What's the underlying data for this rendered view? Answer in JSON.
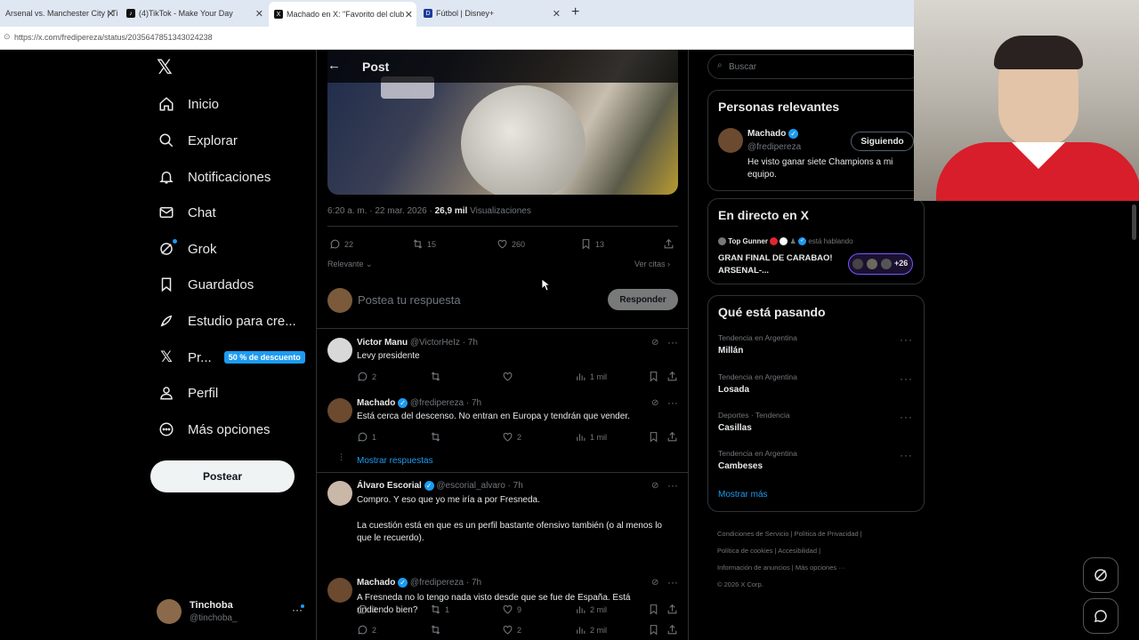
{
  "browser": {
    "tabs": [
      {
        "label": "Arsenal vs. Manchester City | Ti"
      },
      {
        "label": "(4)TikTok - Make Your Day"
      },
      {
        "label": "Machado en X: \"Favorito del club"
      },
      {
        "label": "Fútbol | Disney+"
      }
    ],
    "url": "https://x.com/fredipereza/status/2035647851343024238"
  },
  "nav": {
    "logo": "𝕏",
    "items": [
      {
        "label": "Inicio",
        "icon": "home-icon"
      },
      {
        "label": "Explorar",
        "icon": "search-icon"
      },
      {
        "label": "Notificaciones",
        "icon": "bell-icon"
      },
      {
        "label": "Chat",
        "icon": "mail-icon"
      },
      {
        "label": "Grok",
        "icon": "grok-icon"
      },
      {
        "label": "Guardados",
        "icon": "bookmark-icon"
      },
      {
        "label": "Estudio para cre...",
        "icon": "rocket-icon"
      },
      {
        "label": "Pr...",
        "icon": "x-icon"
      },
      {
        "label": "Perfil",
        "icon": "person-icon"
      },
      {
        "label": "Más opciones",
        "icon": "more-circle-icon"
      }
    ],
    "premium_badge": "50 % de descuento",
    "post_button": "Postear",
    "account": {
      "name": "Tinchoba",
      "handle": "@tinchoba_"
    }
  },
  "post": {
    "header_title": "Post",
    "meta_time": "6:20 a. m. · 22 mar. 2026 · ",
    "meta_views": "26,9 mil",
    "meta_views_label": " Visualizaciones",
    "stats": {
      "replies": "22",
      "reposts": "15",
      "likes": "260",
      "bookmarks": "13"
    },
    "sort_label": "Relevante",
    "quotes_link": "Ver citas",
    "reply_placeholder": "Postea tu respuesta",
    "reply_button": "Responder"
  },
  "replies": [
    {
      "name": "Victor Manu",
      "handle": "@VictorHeIz · 7h",
      "verified": false,
      "text": "Levy presidente",
      "replies": "2",
      "reposts": "",
      "likes": "",
      "views": "1 mil"
    },
    {
      "name": "Machado",
      "handle": "@fredipereza · 7h",
      "verified": true,
      "text": "Está cerca del descenso. No entran en Europa y tendrán que vender.",
      "replies": "1",
      "reposts": "",
      "likes": "2",
      "views": "1 mil"
    },
    {
      "show_replies": "Mostrar respuestas"
    },
    {
      "name": "Álvaro Escorial",
      "handle": "@escorial_alvaro · 7h",
      "verified": true,
      "text": "Compro. Y eso que yo me iría a por Fresneda.",
      "text2": "La cuestión está en que es un perfil bastante ofensivo también (o al menos lo que le recuerdo).",
      "replies": "3",
      "reposts": "1",
      "likes": "9",
      "views": "2 mil"
    },
    {
      "name": "Machado",
      "handle": "@fredipereza · 7h",
      "verified": true,
      "text": "A Fresneda no lo tengo nada visto desde que se fue de España. Está rindiendo bien?",
      "replies": "2",
      "reposts": "",
      "likes": "2",
      "views": "2 mil"
    }
  ],
  "right": {
    "search_placeholder": "Buscar",
    "relevant": {
      "title": "Personas relevantes",
      "name": "Machado",
      "handle": "@fredipereza",
      "follow_button": "Siguiendo",
      "bio": "He visto ganar siete Champions a mi equipo."
    },
    "live": {
      "title": "En directo en X",
      "host": "Top Gunner",
      "status": "está hablando",
      "event": "GRAN FINAL DE CARABAO! ARSENAL-...",
      "listeners": "+26"
    },
    "trends": {
      "title": "Qué está pasando",
      "items": [
        {
          "context": "Tendencia en Argentina",
          "name": "Millán"
        },
        {
          "context": "Tendencia en Argentina",
          "name": "Losada"
        },
        {
          "context": "Deportes · Tendencia",
          "name": "Casillas"
        },
        {
          "context": "Tendencia en Argentina",
          "name": "Cambeses"
        }
      ],
      "show_more": "Mostrar más"
    },
    "footer": {
      "links": [
        "Condiciones de Servicio",
        "Política de Privacidad",
        "Política de cookies",
        "Accesibilidad",
        "Información de anuncios",
        "Más opciones ···"
      ],
      "copyright": "© 2026 X Corp."
    }
  },
  "colors": {
    "accent": "#1d9bf0",
    "background": "#000000",
    "border": "#2f3336",
    "muted": "#71767b"
  }
}
